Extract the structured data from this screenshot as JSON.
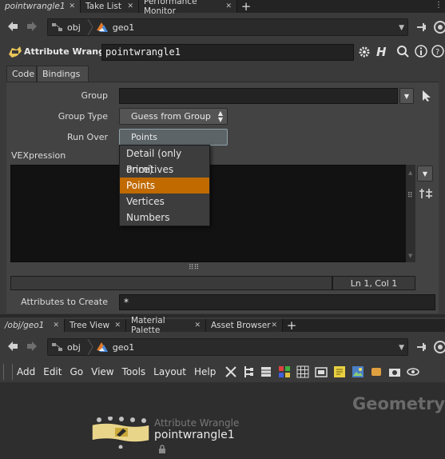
{
  "top_tabs": [
    {
      "label": "pointwrangle1",
      "active": true
    },
    {
      "label": "Take List",
      "active": false
    },
    {
      "label": "Performance Monitor",
      "active": false
    }
  ],
  "top_path": {
    "seg1": "obj",
    "seg2": "geo1"
  },
  "node_header": {
    "type_label": "Attribute Wrangle",
    "name": "pointwrangle1"
  },
  "subtabs": [
    "Code",
    "Bindings"
  ],
  "parms": {
    "group_label": "Group",
    "group_type_label": "Group Type",
    "group_type_value": "Guess from Group",
    "run_over_label": "Run Over",
    "run_over_value": "Points",
    "run_over_options": [
      "Detail (only once)",
      "Primitives",
      "Points",
      "Vertices",
      "Numbers"
    ],
    "run_over_selected_index": 2,
    "vexpression_label": "VEXpression",
    "cursor_pos": "Ln 1, Col 1",
    "attrs_label": "Attributes to Create",
    "attrs_value": "*"
  },
  "bottom_tabs": [
    {
      "label": "/obj/geo1",
      "active": true
    },
    {
      "label": "Tree View",
      "active": false
    },
    {
      "label": "Material Palette",
      "active": false
    },
    {
      "label": "Asset Browser",
      "active": false
    }
  ],
  "bottom_path": {
    "seg1": "obj",
    "seg2": "geo1"
  },
  "menus": [
    "Add",
    "Edit",
    "Go",
    "View",
    "Tools",
    "Layout",
    "Help"
  ],
  "network": {
    "context_label": "Geometry",
    "node_type": "Attribute Wrangle",
    "node_name": "pointwrangle1"
  },
  "colors": {
    "selection": "#c06a00",
    "node_yellow": "#e8d58a"
  }
}
